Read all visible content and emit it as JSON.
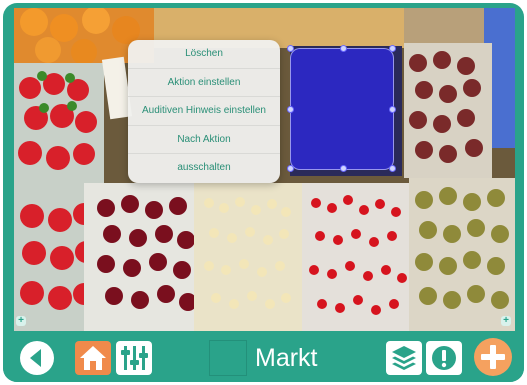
{
  "context_menu": {
    "items": [
      {
        "label": "Löschen"
      },
      {
        "label": "Aktion einstellen"
      },
      {
        "label": "Auditiven Hinweis einstellen"
      },
      {
        "label": "Nach Aktion"
      },
      {
        "label": "ausschalten"
      }
    ]
  },
  "toolbar": {
    "title": "Markt",
    "icons": [
      "back-arrow-icon",
      "home-icon",
      "sliders-icon",
      "layers-icon",
      "exclamation-icon",
      "plus-icon"
    ]
  },
  "colors": {
    "accent": "#2aa38a",
    "accent_dark": "#23907a",
    "home_orange": "#f08a4b",
    "plus_orange": "#f5a15f",
    "selection_blue": "#2d28dc",
    "menu_text": "#2a8f77"
  }
}
